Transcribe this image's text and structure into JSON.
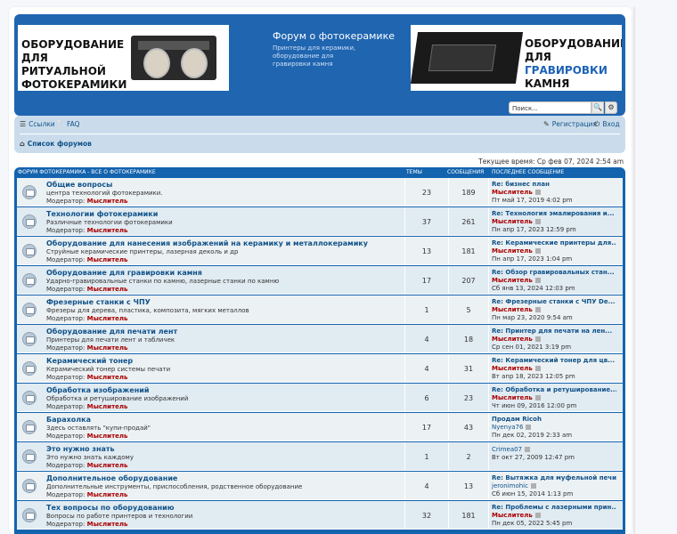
{
  "header": {
    "banner_left_lines": [
      "ОБОРУДОВАНИЕ ДЛЯ",
      "РИТУАЛЬНОЙ",
      "ФОТОКЕРАМИКИ"
    ],
    "site_title": "Форум о фотокерамике",
    "site_description": "Принтеры для керамики, оборудование для гравировки камня",
    "banner_right_line1": "ОБОРУДОВАНИЕ",
    "banner_right_line2_prefix": "ДЛЯ ",
    "banner_right_line2_accent": "ГРАВИРОВКИ",
    "banner_right_line3": "КАМНЯ",
    "search_placeholder": "Поиск...",
    "search_icon": "magnifier-icon",
    "advanced_search_icon": "gear-icon"
  },
  "navbar": {
    "links_label": "Ссылки",
    "faq_label": "FAQ",
    "register_label": "Регистрация",
    "login_label": "Вход",
    "breadcrumb_label": "Список форумов"
  },
  "time_text": "Текущее время: Ср фев 07, 2024 2:54 am",
  "forum_header": {
    "title": "ФОРУМ ФОТОКЕРАМИКА - ВСЕ О ФОТОКЕРАМИКЕ",
    "topics_col": "ТЕМЫ",
    "posts_col": "СООБЩЕНИЯ",
    "last_col": "ПОСЛЕДНЕЕ СООБЩЕНИЕ"
  },
  "moderator_label": "Модератор:",
  "forums": [
    {
      "title": "Общие вопросы",
      "desc": "центра технологий фотокерамики.",
      "mod": "Мыслитель",
      "topics": "23",
      "posts": "189",
      "last_title": "Re: бизнес план",
      "last_author": "Мыслитель",
      "last_date": "Пт май 17, 2019 4:02 pm"
    },
    {
      "title": "Технологии фотокерамики",
      "desc": "Различные технологии фотокерамики",
      "mod": "Мыслитель",
      "topics": "37",
      "posts": "261",
      "last_title": "Re: Технология эмалирования и...",
      "last_author": "Мыслитель",
      "last_date": "Пн апр 17, 2023 12:59 pm"
    },
    {
      "title": "Оборудование для нанесения изображений на керамику и металлокерамику",
      "desc": "Струйные керамические принтеры, лазерная деколь и др",
      "mod": "Мыслитель",
      "topics": "13",
      "posts": "181",
      "last_title": "Re: Керамические принтеры для...",
      "last_author": "Мыслитель",
      "last_date": "Пн апр 17, 2023 1:04 pm"
    },
    {
      "title": "Оборудование для гравировки камня",
      "desc": "Ударно-гравировальные станки по камню, лазерные станки по камню",
      "mod": "Мыслитель",
      "topics": "17",
      "posts": "207",
      "last_title": "Re: Обзор гравировальных стан...",
      "last_author": "Мыслитель",
      "last_date": "Сб янв 13, 2024 12:03 pm"
    },
    {
      "title": "Фрезерные станки с ЧПУ",
      "desc": "Фрезеры для дерева, пластика, композита, мягких металлов",
      "mod": "Мыслитель",
      "topics": "1",
      "posts": "5",
      "last_title": "Re: Фрезерные станки с ЧПУ De...",
      "last_author": "Мыслитель",
      "last_date": "Пн мар 23, 2020 9:54 am"
    },
    {
      "title": "Оборудование для печати лент",
      "desc": "Принтеры для печати лент и табличек",
      "mod": "Мыслитель",
      "topics": "4",
      "posts": "18",
      "last_title": "Re: Принтер для печати на лен...",
      "last_author": "Мыслитель",
      "last_date": "Ср сен 01, 2021 3:19 pm"
    },
    {
      "title": "Керамический тонер",
      "desc": "Керамический тонер системы печати",
      "mod": "Мыслитель",
      "topics": "4",
      "posts": "31",
      "last_title": "Re: Керамический тонер для цв...",
      "last_author": "Мыслитель",
      "last_date": "Вт апр 18, 2023 12:05 pm"
    },
    {
      "title": "Обработка изображений",
      "desc": "Обработка и ретуширование изображений",
      "mod": "Мыслитель",
      "topics": "6",
      "posts": "23",
      "last_title": "Re: Обработка и ретуширование...",
      "last_author": "Мыслитель",
      "last_date": "Чт июн 09, 2016 12:00 pm"
    },
    {
      "title": "Барахолка",
      "desc": "Здесь оставлять \"купи-продай\"",
      "mod": "Мыслитель",
      "topics": "17",
      "posts": "43",
      "last_title": "Продам Ricoh",
      "last_author": "Nyenya76",
      "last_date": "Пн дек 02, 2019 2:33 am",
      "plain_author": true
    },
    {
      "title": "Это нужно знать",
      "desc": "Это нужно знать каждому",
      "mod": "Мыслитель",
      "topics": "1",
      "posts": "2",
      "last_title": "",
      "last_author": "Crimea07",
      "last_date": "Вт окт 27, 2009 12:47 pm",
      "plain_author": true
    },
    {
      "title": "Дополнительное оборудование",
      "desc": "Дополнительные инструменты, приспособления, родственное оборудование",
      "mod": "Мыслитель",
      "topics": "4",
      "posts": "13",
      "last_title": "Re: Вытяжка для муфельной печи",
      "last_author": "jeronimohic",
      "last_date": "Сб июн 15, 2014 1:13 pm",
      "plain_author": true
    },
    {
      "title": "Тех вопросы по оборудованию",
      "desc": "Вопросы по работе принтеров и технологии",
      "mod": "Мыслитель",
      "topics": "32",
      "posts": "181",
      "last_title": "Re: Проблемы с лазерными прин...",
      "last_author": "Мыслитель",
      "last_date": "Пн дек 05, 2022 5:45 pm"
    }
  ],
  "colors": {
    "header_blue": "#1f65b0",
    "navbar": "#cadceb",
    "row": "#ecf1f3",
    "row_alt": "#e1ebf2",
    "moderator_red": "#aa0000",
    "link_blue": "#105289"
  }
}
